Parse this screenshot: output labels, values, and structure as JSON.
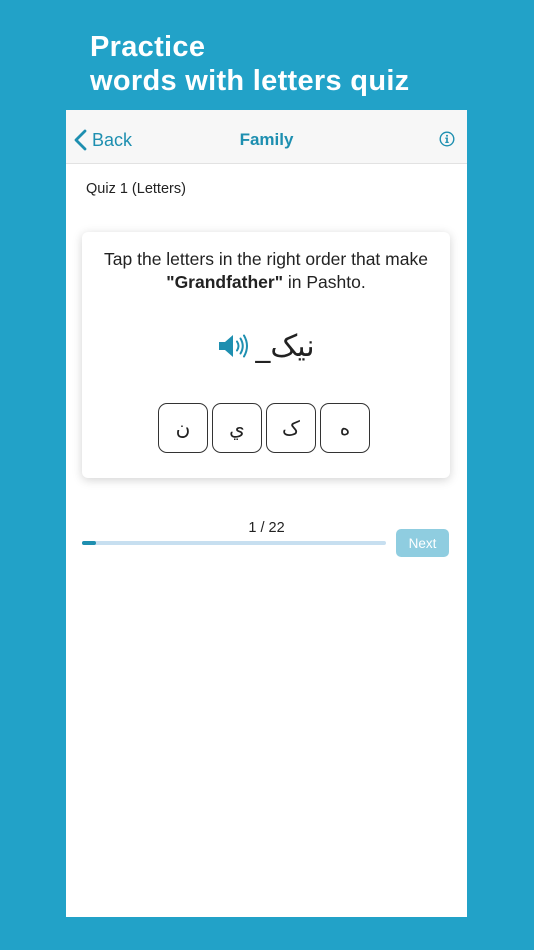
{
  "promo": {
    "line1": "Practice",
    "line2": "words with letters quiz"
  },
  "navbar": {
    "back_label": "Back",
    "title": "Family",
    "info_icon": "info-circle-icon"
  },
  "quiz": {
    "label": "Quiz 1 (Letters)",
    "instruction_prefix": "Tap the letters in the right order that make",
    "target_word": "\"Grandfather\"",
    "instruction_suffix": " in Pashto.",
    "speaker_icon": "speaker-icon",
    "partial_word": "نیک_",
    "letters": [
      "ن",
      "ي",
      "ک",
      "ه"
    ]
  },
  "progress": {
    "label": "1 / 22",
    "current": 1,
    "total": 22
  },
  "next_button": {
    "label": "Next",
    "enabled": false
  },
  "colors": {
    "background": "#22a2c8",
    "accent": "#1e8fb0",
    "next_disabled": "#8fcde0"
  }
}
